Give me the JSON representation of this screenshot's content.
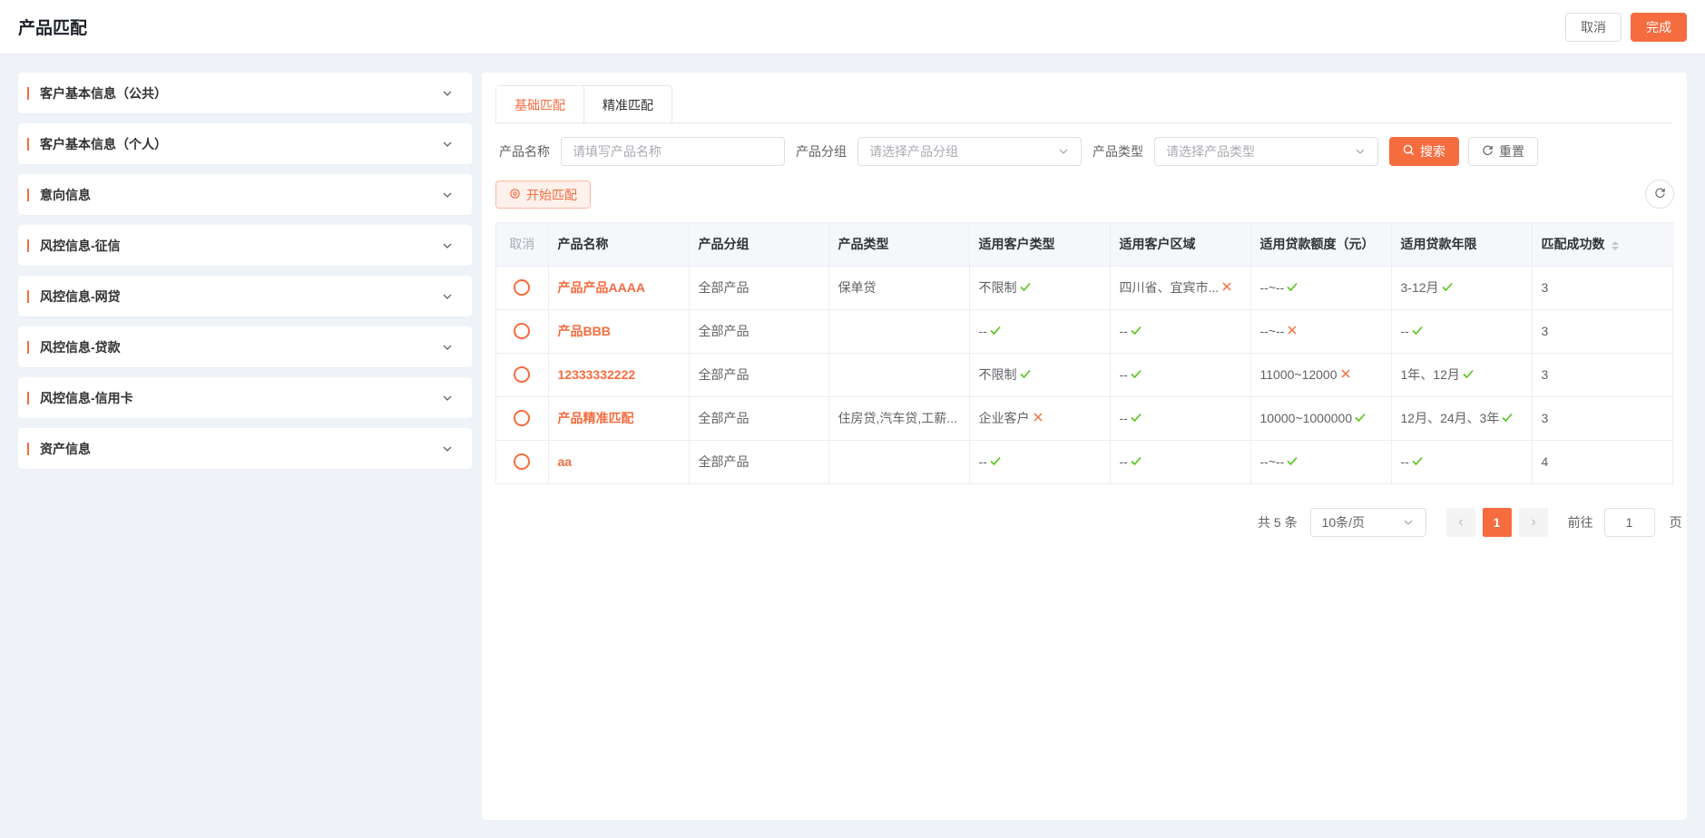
{
  "header": {
    "title": "产品匹配",
    "cancel_label": "取消",
    "done_label": "完成"
  },
  "sidebar": {
    "sections": [
      {
        "label": "客户基本信息（公共）"
      },
      {
        "label": "客户基本信息（个人）"
      },
      {
        "label": "意向信息"
      },
      {
        "label": "风控信息-征信"
      },
      {
        "label": "风控信息-网贷"
      },
      {
        "label": "风控信息-贷款"
      },
      {
        "label": "风控信息-信用卡"
      },
      {
        "label": "资产信息"
      }
    ]
  },
  "tabs": [
    {
      "label": "基础匹配",
      "active": true
    },
    {
      "label": "精准匹配",
      "active": false
    }
  ],
  "filters": {
    "product_name_label": "产品名称",
    "product_name_placeholder": "请填写产品名称",
    "product_group_label": "产品分组",
    "product_group_placeholder": "请选择产品分组",
    "product_type_label": "产品类型",
    "product_type_placeholder": "请选择产品类型",
    "search_label": "搜索",
    "reset_label": "重置"
  },
  "start_match_label": "开始匹配",
  "table": {
    "headers": [
      "取消",
      "产品名称",
      "产品分组",
      "产品类型",
      "适用客户类型",
      "适用客户区域",
      "适用贷款额度（元）",
      "适用贷款年限",
      "匹配成功数"
    ],
    "rows": [
      {
        "name": "产品产品AAAA",
        "group": "全部产品",
        "type": "保单贷",
        "cust_type": "不限制",
        "cust_type_ok": true,
        "region": "四川省、宜宾市...",
        "region_ok": false,
        "amount": "--~--",
        "amount_ok": true,
        "term": "3-12月",
        "term_ok": true,
        "count": "3"
      },
      {
        "name": "产品BBB",
        "group": "全部产品",
        "type": "",
        "cust_type": "--",
        "cust_type_ok": true,
        "region": "--",
        "region_ok": true,
        "amount": "--~--",
        "amount_ok": false,
        "term": "--",
        "term_ok": true,
        "count": "3"
      },
      {
        "name": "12333332222",
        "group": "全部产品",
        "type": "",
        "cust_type": "不限制",
        "cust_type_ok": true,
        "region": "--",
        "region_ok": true,
        "amount": "11000~12000",
        "amount_ok": false,
        "term": "1年、12月",
        "term_ok": true,
        "count": "3"
      },
      {
        "name": "产品精准匹配",
        "group": "全部产品",
        "type": "住房贷,汽车贷,工薪...",
        "cust_type": "企业客户",
        "cust_type_ok": false,
        "region": "--",
        "region_ok": true,
        "amount": "10000~1000000",
        "amount_ok": true,
        "term": "12月、24月、3年",
        "term_ok": true,
        "count": "3"
      },
      {
        "name": "aa",
        "group": "全部产品",
        "type": "",
        "cust_type": "--",
        "cust_type_ok": true,
        "region": "--",
        "region_ok": true,
        "amount": "--~--",
        "amount_ok": true,
        "term": "--",
        "term_ok": true,
        "count": "4"
      }
    ]
  },
  "pagination": {
    "total": "共 5 条",
    "page_size": "10条/页",
    "current_page": "1",
    "goto_label": "前往",
    "goto_value": "1",
    "page_suffix": "页"
  },
  "colors": {
    "accent": "#f56c3f",
    "ok": "#52c41a",
    "fail": "#f56c3f"
  }
}
